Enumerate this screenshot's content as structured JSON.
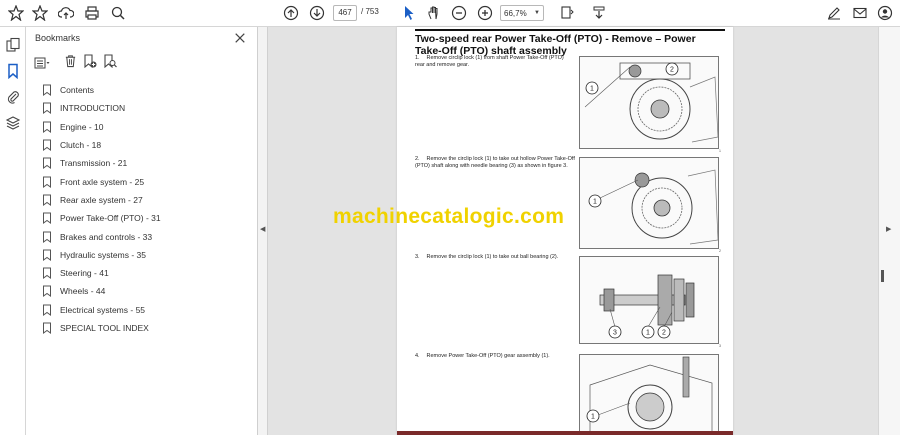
{
  "toolbar": {
    "page_current": "467",
    "page_total": "/ 753",
    "zoom": "66,7%"
  },
  "panel": {
    "title": "Bookmarks",
    "items": [
      {
        "label": "Contents"
      },
      {
        "label": "INTRODUCTION"
      },
      {
        "label": "Engine - 10"
      },
      {
        "label": "Clutch - 18"
      },
      {
        "label": "Transmission - 21"
      },
      {
        "label": "Front axle system - 25"
      },
      {
        "label": "Rear axle system - 27"
      },
      {
        "label": "Power Take-Off (PTO) - 31"
      },
      {
        "label": "Brakes and controls - 33"
      },
      {
        "label": "Hydraulic systems - 35"
      },
      {
        "label": "Steering - 41"
      },
      {
        "label": "Wheels - 44"
      },
      {
        "label": "Electrical systems - 55"
      },
      {
        "label": "SPECIAL TOOL INDEX"
      }
    ]
  },
  "document": {
    "title": "Two-speed rear Power Take-Off (PTO) - Remove – Power Take-Off (PTO) shaft assembly",
    "steps": [
      {
        "num": "1.",
        "text": "Remove circlip lock (1) from shaft Power Take-Off (PTO) rear and remove gear.",
        "caption": "1"
      },
      {
        "num": "2.",
        "text": "Remove the circlip lock (1) to take out hollow Power Take-Off (PTO) shaft along with needle bearing (3) as shown in figure 3.",
        "caption": "2"
      },
      {
        "num": "3.",
        "text": "Remove the circlip lock (1) to take out ball bearing (2).",
        "caption": "3"
      },
      {
        "num": "4.",
        "text": "Remove Power Take-Off (PTO) gear assembly (1).",
        "caption": ""
      }
    ]
  },
  "watermark": "machinecatalogic.com"
}
